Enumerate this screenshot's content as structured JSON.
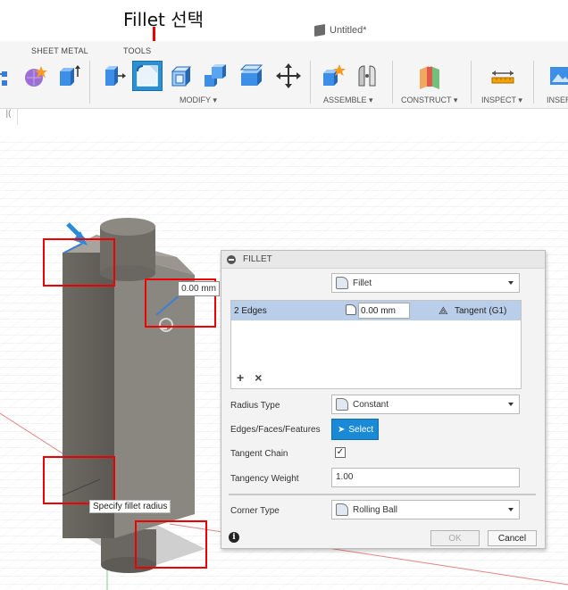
{
  "annotation": {
    "title": "Fillet 선택"
  },
  "window": {
    "title": "Untitled*"
  },
  "ribbon": {
    "tabs": [
      "SHEET METAL",
      "TOOLS"
    ],
    "groups": [
      "MODIFY ▾",
      "ASSEMBLE ▾",
      "CONSTRUCT ▾",
      "INSPECT ▾",
      "INSER"
    ]
  },
  "browser": {
    "marker": "|("
  },
  "viewport": {
    "radius_value": "0.00 mm",
    "tooltip": "Specify fillet radius"
  },
  "dialog": {
    "title": "FILLET",
    "type_label": "Fillet",
    "edges": {
      "label": "2 Edges",
      "value": "0.00 mm",
      "continuity": "Tangent (G1)"
    },
    "list_add": "+",
    "list_remove": "×",
    "radius_type_label": "Radius Type",
    "radius_type_value": "Constant",
    "edges_label": "Edges/Faces/Features",
    "select_label": "Select",
    "tangent_chain_label": "Tangent Chain",
    "tangent_chain_checked": "✓",
    "tangency_weight_label": "Tangency Weight",
    "tangency_weight_value": "1.00",
    "corner_type_label": "Corner Type",
    "corner_type_value": "Rolling Ball",
    "info": "i",
    "ok_label": "OK",
    "cancel_label": "Cancel"
  },
  "colors": {
    "accent": "#2c8fd1",
    "annotation_red": "#e00000",
    "selected_row": "#b9cfe9"
  }
}
